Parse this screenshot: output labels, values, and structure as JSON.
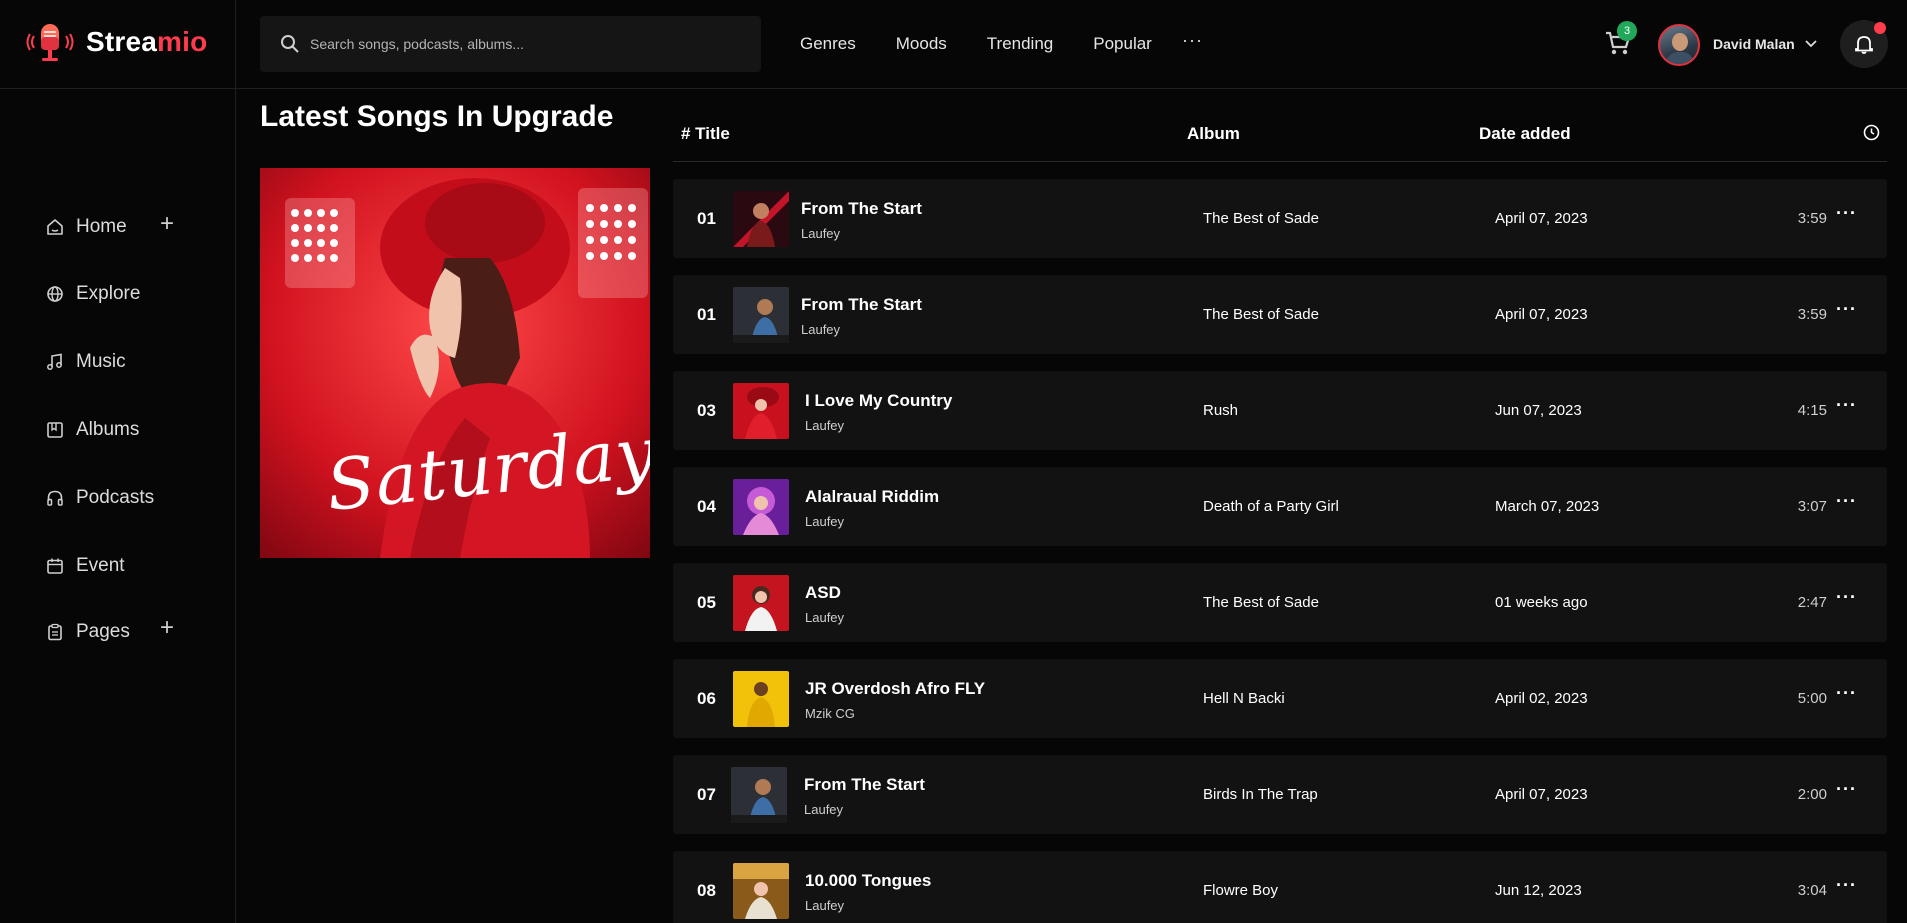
{
  "brand": {
    "name_main": "Strea",
    "name_accent": "mio"
  },
  "search": {
    "placeholder": "Search songs, podcasts, albums..."
  },
  "topnav": [
    "Genres",
    "Moods",
    "Trending",
    "Popular"
  ],
  "cart": {
    "count": "3"
  },
  "user": {
    "name": "David Malan"
  },
  "sidebar": [
    {
      "label": "Home",
      "icon": "home-icon",
      "expandable": true
    },
    {
      "label": "Explore",
      "icon": "globe-icon"
    },
    {
      "label": "Music",
      "icon": "music-note-icon"
    },
    {
      "label": "Albums",
      "icon": "album-icon"
    },
    {
      "label": "Podcasts",
      "icon": "headphones-icon"
    },
    {
      "label": "Event",
      "icon": "calendar-icon"
    },
    {
      "label": "Pages",
      "icon": "clipboard-icon",
      "expandable": true
    }
  ],
  "section": {
    "title": "Latest Songs In Upgrade",
    "cover_text": "Saturday"
  },
  "table": {
    "headers": {
      "title": "# Title",
      "album": "Album",
      "date": "Date added"
    },
    "rows": [
      {
        "num": "01",
        "title": "From The Start",
        "artist": "Laufey",
        "album": "The Best of Sade",
        "date": "April 07, 2023",
        "duration": "3:59",
        "thumb_color": "#b3122a"
      },
      {
        "num": "01",
        "title": "From The Start",
        "artist": "Laufey",
        "album": "The Best of Sade",
        "date": "April 07, 2023",
        "duration": "3:59",
        "thumb_color": "#3a3f46"
      },
      {
        "num": "03",
        "title": "I Love My Country",
        "artist": "Laufey",
        "album": "Rush",
        "date": "Jun 07, 2023",
        "duration": "4:15",
        "thumb_color": "#c8101e"
      },
      {
        "num": "04",
        "title": "Alalraual Riddim",
        "artist": "Laufey",
        "album": "Death of a Party Girl",
        "date": "March 07, 2023",
        "duration": "3:07",
        "thumb_color": "#8a2bb8"
      },
      {
        "num": "05",
        "title": "ASD",
        "artist": "Laufey",
        "album": "The Best of Sade",
        "date": "01 weeks ago",
        "duration": "2:47",
        "thumb_color": "#c4141f"
      },
      {
        "num": "06",
        "title": "JR Overdosh Afro FLY",
        "artist": "Mzik CG",
        "album": "Hell N Backi",
        "date": "April 02, 2023",
        "duration": "5:00",
        "thumb_color": "#f2c20a"
      },
      {
        "num": "07",
        "title": "From The Start",
        "artist": "Laufey",
        "album": "Birds In The Trap",
        "date": "April 07, 2023",
        "duration": "2:00",
        "thumb_color": "#3a3f46"
      },
      {
        "num": "08",
        "title": "10.000 Tongues",
        "artist": "Laufey",
        "album": "Flowre Boy",
        "date": "Jun 12, 2023",
        "duration": "3:04",
        "thumb_color": "#b8872a"
      }
    ]
  },
  "colors": {
    "accent": "#ff3b4e",
    "badge": "#22a85a",
    "row_bg": "#121212"
  }
}
